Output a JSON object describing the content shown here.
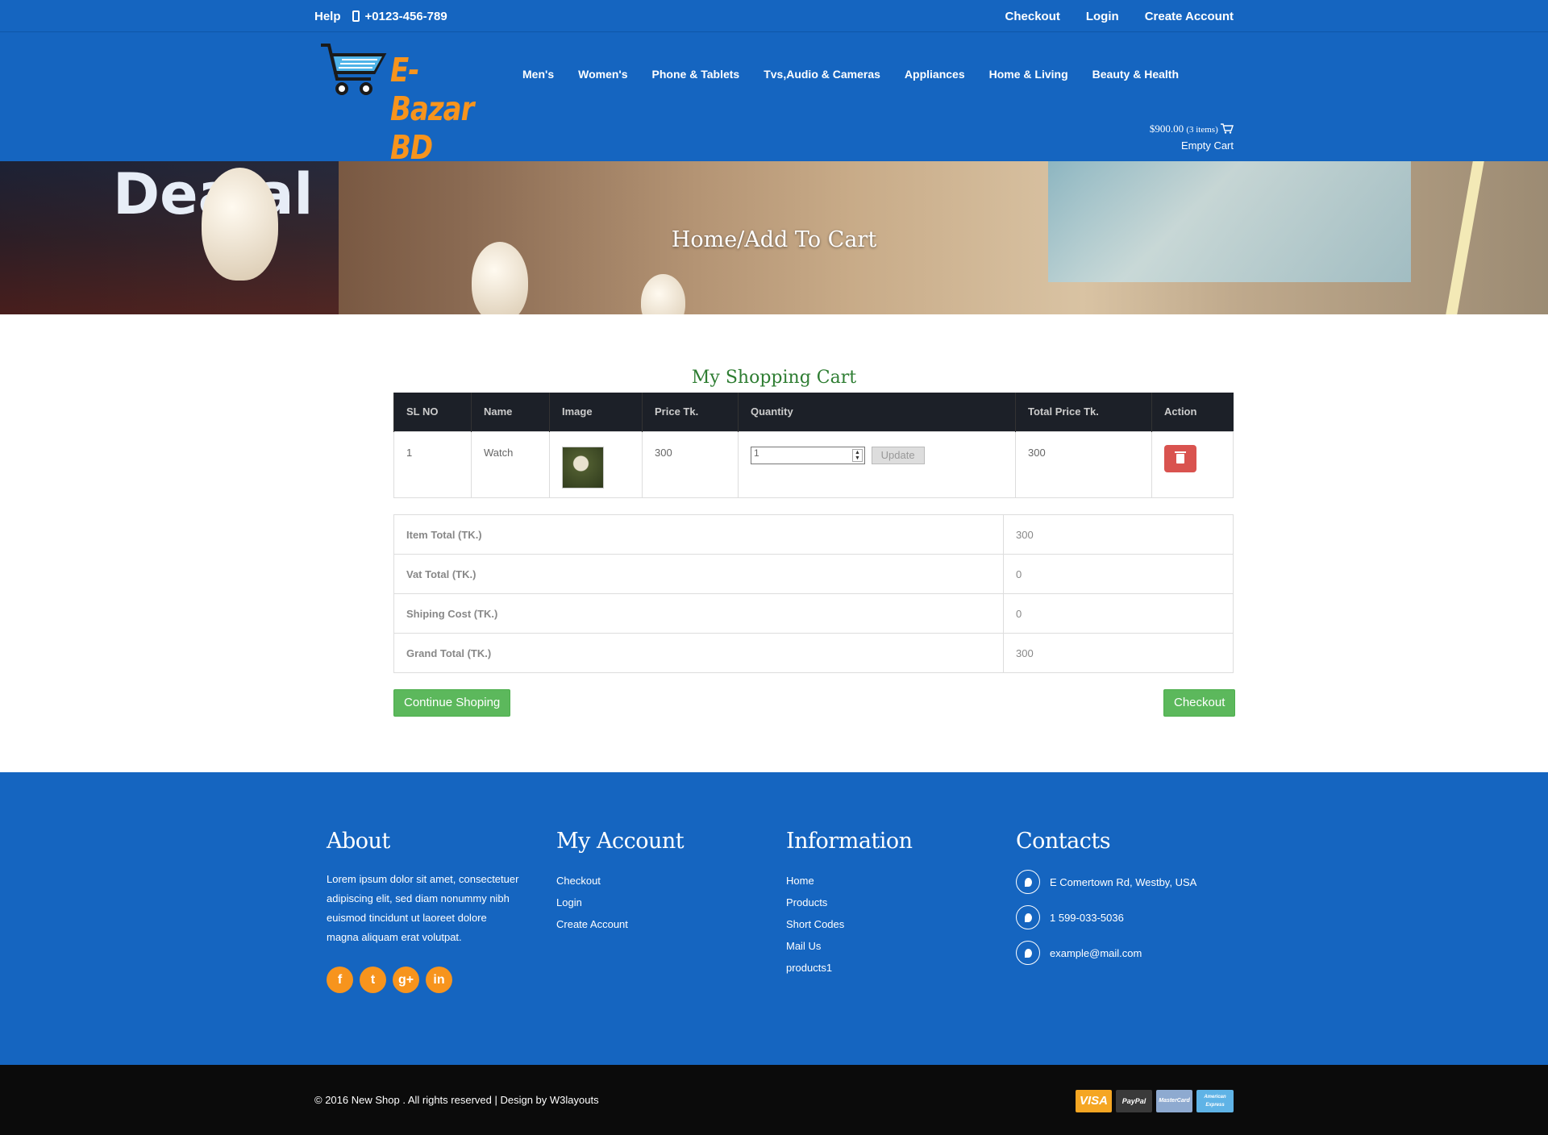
{
  "topbar": {
    "help": "Help",
    "phone": "+0123-456-789",
    "checkout": "Checkout",
    "login": "Login",
    "create_account": "Create Account"
  },
  "header": {
    "logo_text": "E-Bazar BD",
    "nav": [
      "Men's",
      "Women's",
      "Phone & Tablets",
      "Tvs,Audio & Cameras",
      "Appliances",
      "Home & Living",
      "Beauty & Health"
    ],
    "cart_total": "$900.00",
    "cart_items": "(3 items)",
    "empty_cart": "Empty Cart"
  },
  "banner": {
    "title": "Home/Add To Cart",
    "sign": "Dea   al"
  },
  "cart": {
    "title": "My Shopping Cart",
    "columns": [
      "SL NO",
      "Name",
      "Image",
      "Price Tk.",
      "Quantity",
      "Total Price Tk.",
      "Action"
    ],
    "rows": [
      {
        "sl": "1",
        "name": "Watch",
        "price": "300",
        "quantity": "1",
        "total": "300",
        "update_label": "Update"
      }
    ]
  },
  "totals": [
    {
      "label": "Item Total (TK.)",
      "value": "300"
    },
    {
      "label": "Vat Total (TK.)",
      "value": "0"
    },
    {
      "label": "Shiping Cost (TK.)",
      "value": "0"
    },
    {
      "label": "Grand Total (TK.)",
      "value": "300"
    }
  ],
  "buttons": {
    "continue": "Continue Shoping",
    "checkout": "Checkout"
  },
  "footer": {
    "about_title": "About",
    "about_text": "Lorem ipsum dolor sit amet, consectetuer adipiscing elit, sed diam nonummy nibh euismod tincidunt ut laoreet dolore magna aliquam erat volutpat.",
    "social": [
      "f",
      "t",
      "g+",
      "in"
    ],
    "account_title": "My Account",
    "account_links": [
      "Checkout",
      "Login",
      "Create Account"
    ],
    "info_title": "Information",
    "info_links": [
      "Home",
      "Products",
      "Short Codes",
      "Mail Us",
      "products1"
    ],
    "contacts_title": "Contacts",
    "address": "E Comertown Rd, Westby, USA",
    "phone": "1 599-033-5036",
    "email": "example@mail.com"
  },
  "copyright": "© 2016 New Shop . All rights reserved | Design by  W3layouts",
  "payments": [
    "VISA",
    "PayPal",
    "MasterCard",
    "American Express"
  ],
  "colors": {
    "brand_blue": "#1565c0",
    "accent_orange": "#f7941d",
    "success_green": "#5cb85c",
    "danger_red": "#d9534f"
  }
}
